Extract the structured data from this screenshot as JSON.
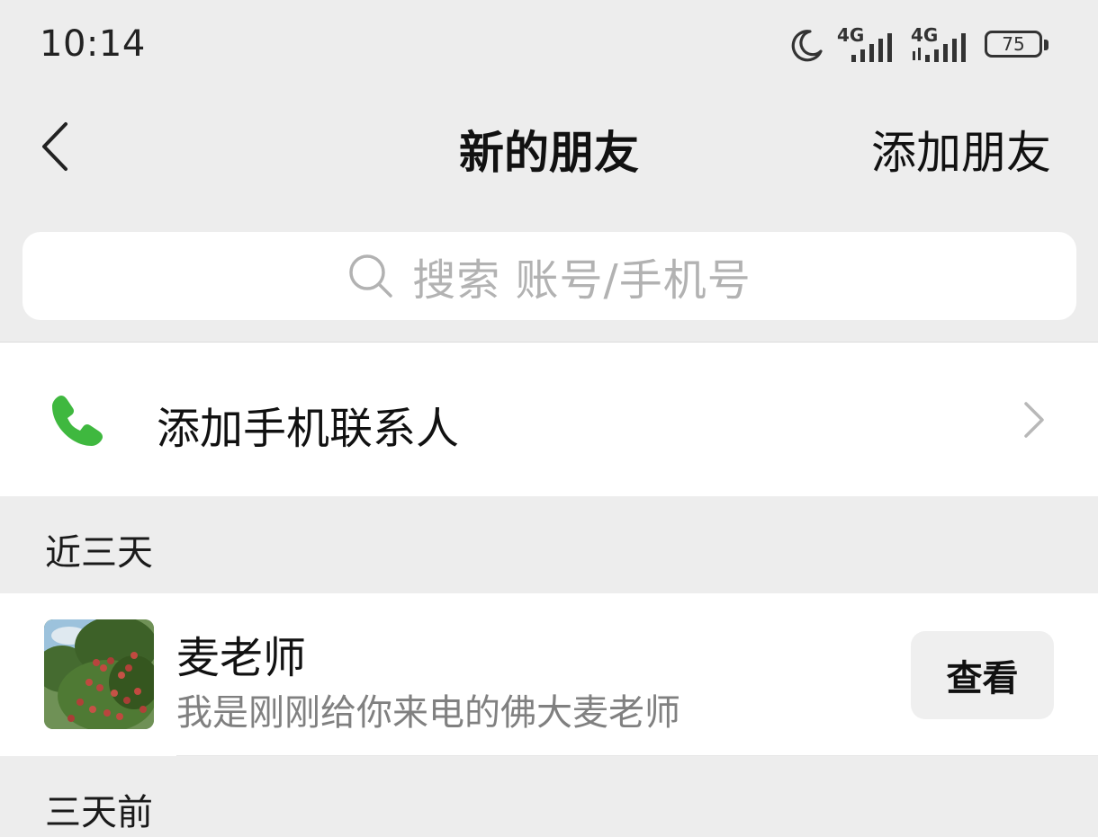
{
  "status_bar": {
    "time": "10:14",
    "network_1": "4G",
    "network_2": "4G",
    "battery": "75",
    "icons": [
      "moon-icon",
      "signal-icon",
      "signal-icon",
      "battery-icon"
    ]
  },
  "nav": {
    "title": "新的朋友",
    "action_label": "添加朋友",
    "back_icon": "chevron-left-icon"
  },
  "search": {
    "placeholder": "搜索 账号/手机号",
    "icon": "search-icon"
  },
  "add_contacts": {
    "label": "添加手机联系人",
    "icon": "phone-icon",
    "icon_color": "#3fb83f"
  },
  "sections": [
    {
      "label": "近三天",
      "items": [
        {
          "name": "麦老师",
          "message": "我是刚刚给你来电的佛大麦老师",
          "action_label": "查看"
        }
      ]
    },
    {
      "label": "三天前",
      "items": []
    }
  ]
}
